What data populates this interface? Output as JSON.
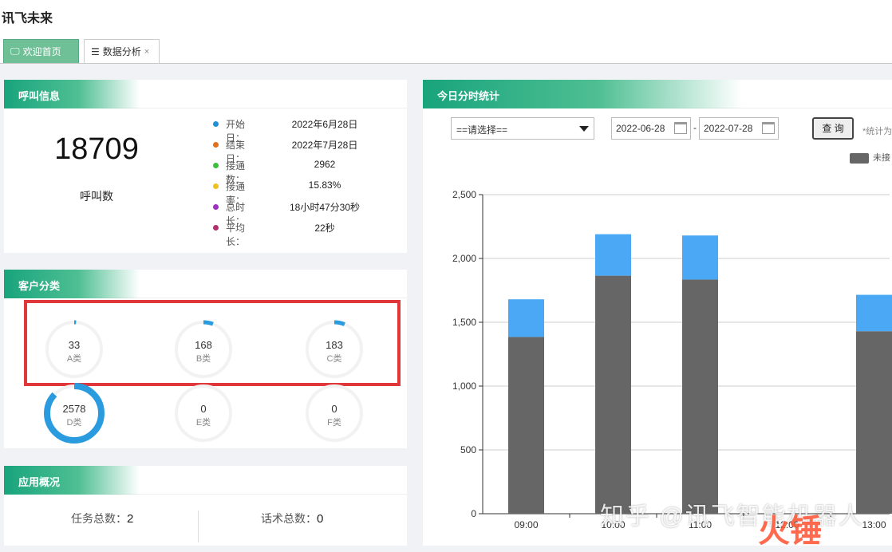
{
  "app": {
    "title": "讯飞未来"
  },
  "tabs": [
    {
      "label": "欢迎首页",
      "icon": "monitor-icon",
      "active": true
    },
    {
      "label": "数据分析",
      "icon": "list-icon",
      "close": "×",
      "active": false
    }
  ],
  "call_info": {
    "title": "呼叫信息",
    "total": "18709",
    "total_label": "呼叫数",
    "stats": [
      {
        "key": "开始日：",
        "value": "2022年6月28日",
        "color": "#1e90d6"
      },
      {
        "key": "结束日：",
        "value": "2022年7月28日",
        "color": "#e07020"
      },
      {
        "key": "接通数：",
        "value": "2962",
        "color": "#3cc03c"
      },
      {
        "key": "接通率：",
        "value": "15.83%",
        "color": "#f0c020"
      },
      {
        "key": "总时长：",
        "value": "18小时47分30秒",
        "color": "#a030c0"
      },
      {
        "key": "平均长：",
        "value": "22秒",
        "color": "#b03070"
      }
    ]
  },
  "customer": {
    "title": "客户分类",
    "accent": "#2b9be0",
    "rings": [
      {
        "num": "33",
        "label": "A类",
        "fraction": 0.011
      },
      {
        "num": "168",
        "label": "B类",
        "fraction": 0.057
      },
      {
        "num": "183",
        "label": "C类",
        "fraction": 0.062
      },
      {
        "num": "2578",
        "label": "D类",
        "fraction": 0.87
      },
      {
        "num": "0",
        "label": "E类",
        "fraction": 0
      },
      {
        "num": "0",
        "label": "F类",
        "fraction": 0
      }
    ]
  },
  "app_overview": {
    "title": "应用概况",
    "tasks_label": "任务总数：",
    "tasks": "2",
    "scripts_label": "话术总数：",
    "scripts": "0"
  },
  "today": {
    "title": "今日分时统计",
    "select_value": "==请选择==",
    "date_from": "2022-06-28",
    "date_sep": "-",
    "date_to": "2022-07-28",
    "query_label": "查 询",
    "note": "*统计为",
    "legend_label": "未接"
  },
  "chart_data": {
    "type": "bar",
    "stacked": true,
    "categories": [
      "09:00",
      "10:00",
      "11:00",
      "12:00",
      "13:00"
    ],
    "series": [
      {
        "name": "未接",
        "color": "#666666",
        "values": [
          1385,
          1865,
          1835,
          0,
          1430
        ]
      },
      {
        "color": "#4aa8f5",
        "values": [
          295,
          325,
          345,
          0,
          285
        ]
      }
    ],
    "ylim": [
      0,
      2500
    ],
    "yticks": [
      "0",
      "500",
      "1,000",
      "1,500",
      "2,000",
      "2,500"
    ],
    "grid": true
  },
  "watermark": {
    "text": "知乎 @讯飞智能机器人",
    "logo": "火锤"
  }
}
